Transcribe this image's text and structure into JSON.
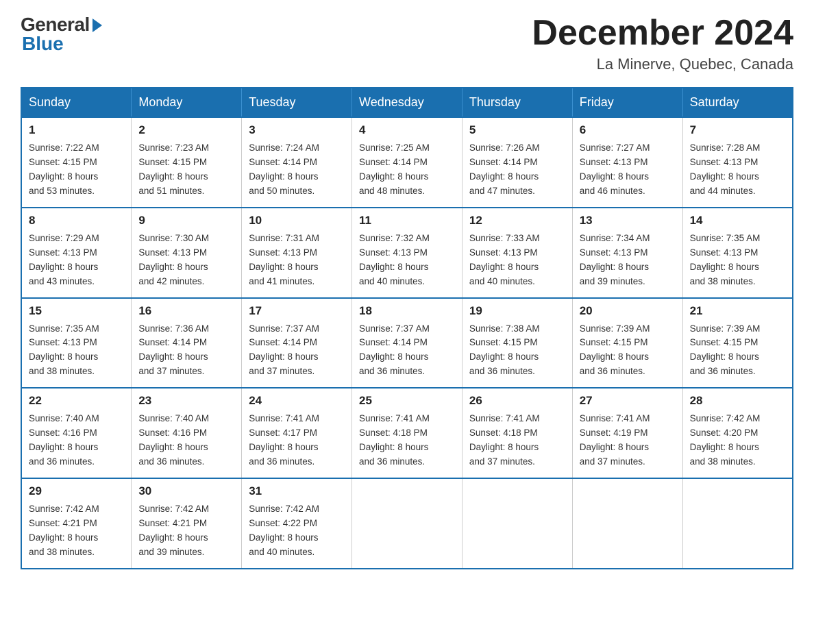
{
  "logo": {
    "general": "General",
    "blue": "Blue"
  },
  "title": "December 2024",
  "location": "La Minerve, Quebec, Canada",
  "days_of_week": [
    "Sunday",
    "Monday",
    "Tuesday",
    "Wednesday",
    "Thursday",
    "Friday",
    "Saturday"
  ],
  "weeks": [
    [
      {
        "day": "1",
        "sunrise": "7:22 AM",
        "sunset": "4:15 PM",
        "daylight": "8 hours and 53 minutes."
      },
      {
        "day": "2",
        "sunrise": "7:23 AM",
        "sunset": "4:15 PM",
        "daylight": "8 hours and 51 minutes."
      },
      {
        "day": "3",
        "sunrise": "7:24 AM",
        "sunset": "4:14 PM",
        "daylight": "8 hours and 50 minutes."
      },
      {
        "day": "4",
        "sunrise": "7:25 AM",
        "sunset": "4:14 PM",
        "daylight": "8 hours and 48 minutes."
      },
      {
        "day": "5",
        "sunrise": "7:26 AM",
        "sunset": "4:14 PM",
        "daylight": "8 hours and 47 minutes."
      },
      {
        "day": "6",
        "sunrise": "7:27 AM",
        "sunset": "4:13 PM",
        "daylight": "8 hours and 46 minutes."
      },
      {
        "day": "7",
        "sunrise": "7:28 AM",
        "sunset": "4:13 PM",
        "daylight": "8 hours and 44 minutes."
      }
    ],
    [
      {
        "day": "8",
        "sunrise": "7:29 AM",
        "sunset": "4:13 PM",
        "daylight": "8 hours and 43 minutes."
      },
      {
        "day": "9",
        "sunrise": "7:30 AM",
        "sunset": "4:13 PM",
        "daylight": "8 hours and 42 minutes."
      },
      {
        "day": "10",
        "sunrise": "7:31 AM",
        "sunset": "4:13 PM",
        "daylight": "8 hours and 41 minutes."
      },
      {
        "day": "11",
        "sunrise": "7:32 AM",
        "sunset": "4:13 PM",
        "daylight": "8 hours and 40 minutes."
      },
      {
        "day": "12",
        "sunrise": "7:33 AM",
        "sunset": "4:13 PM",
        "daylight": "8 hours and 40 minutes."
      },
      {
        "day": "13",
        "sunrise": "7:34 AM",
        "sunset": "4:13 PM",
        "daylight": "8 hours and 39 minutes."
      },
      {
        "day": "14",
        "sunrise": "7:35 AM",
        "sunset": "4:13 PM",
        "daylight": "8 hours and 38 minutes."
      }
    ],
    [
      {
        "day": "15",
        "sunrise": "7:35 AM",
        "sunset": "4:13 PM",
        "daylight": "8 hours and 38 minutes."
      },
      {
        "day": "16",
        "sunrise": "7:36 AM",
        "sunset": "4:14 PM",
        "daylight": "8 hours and 37 minutes."
      },
      {
        "day": "17",
        "sunrise": "7:37 AM",
        "sunset": "4:14 PM",
        "daylight": "8 hours and 37 minutes."
      },
      {
        "day": "18",
        "sunrise": "7:37 AM",
        "sunset": "4:14 PM",
        "daylight": "8 hours and 36 minutes."
      },
      {
        "day": "19",
        "sunrise": "7:38 AM",
        "sunset": "4:15 PM",
        "daylight": "8 hours and 36 minutes."
      },
      {
        "day": "20",
        "sunrise": "7:39 AM",
        "sunset": "4:15 PM",
        "daylight": "8 hours and 36 minutes."
      },
      {
        "day": "21",
        "sunrise": "7:39 AM",
        "sunset": "4:15 PM",
        "daylight": "8 hours and 36 minutes."
      }
    ],
    [
      {
        "day": "22",
        "sunrise": "7:40 AM",
        "sunset": "4:16 PM",
        "daylight": "8 hours and 36 minutes."
      },
      {
        "day": "23",
        "sunrise": "7:40 AM",
        "sunset": "4:16 PM",
        "daylight": "8 hours and 36 minutes."
      },
      {
        "day": "24",
        "sunrise": "7:41 AM",
        "sunset": "4:17 PM",
        "daylight": "8 hours and 36 minutes."
      },
      {
        "day": "25",
        "sunrise": "7:41 AM",
        "sunset": "4:18 PM",
        "daylight": "8 hours and 36 minutes."
      },
      {
        "day": "26",
        "sunrise": "7:41 AM",
        "sunset": "4:18 PM",
        "daylight": "8 hours and 37 minutes."
      },
      {
        "day": "27",
        "sunrise": "7:41 AM",
        "sunset": "4:19 PM",
        "daylight": "8 hours and 37 minutes."
      },
      {
        "day": "28",
        "sunrise": "7:42 AM",
        "sunset": "4:20 PM",
        "daylight": "8 hours and 38 minutes."
      }
    ],
    [
      {
        "day": "29",
        "sunrise": "7:42 AM",
        "sunset": "4:21 PM",
        "daylight": "8 hours and 38 minutes."
      },
      {
        "day": "30",
        "sunrise": "7:42 AM",
        "sunset": "4:21 PM",
        "daylight": "8 hours and 39 minutes."
      },
      {
        "day": "31",
        "sunrise": "7:42 AM",
        "sunset": "4:22 PM",
        "daylight": "8 hours and 40 minutes."
      },
      null,
      null,
      null,
      null
    ]
  ],
  "labels": {
    "sunrise": "Sunrise:",
    "sunset": "Sunset:",
    "daylight": "Daylight:"
  }
}
